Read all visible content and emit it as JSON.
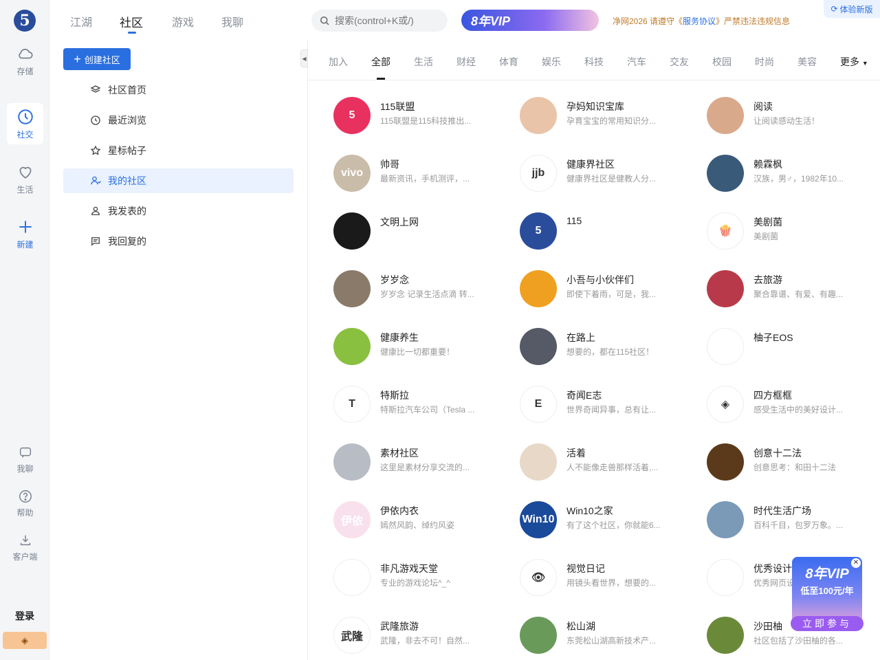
{
  "rail": {
    "logo": "5",
    "items": [
      {
        "label": "存储",
        "icon": "cloud-icon"
      },
      {
        "label": "社交",
        "icon": "compass-icon"
      },
      {
        "label": "生活",
        "icon": "heart-icon"
      },
      {
        "label": "新建",
        "icon": "plus-icon"
      }
    ],
    "bottom": [
      {
        "label": "我聊",
        "icon": "chat-icon"
      },
      {
        "label": "帮助",
        "icon": "help-icon"
      },
      {
        "label": "客户端",
        "icon": "download-icon"
      }
    ],
    "login": "登录"
  },
  "topnav": {
    "tabs": [
      "江湖",
      "社区",
      "游戏",
      "我聊"
    ],
    "active": "社区"
  },
  "search": {
    "placeholder": "搜索(control+K或/)"
  },
  "vip_banner": "8年VIP",
  "notice": {
    "pre": "净网2026 请遵守《",
    "link": "服务协议",
    "post": "》严禁违法违规信息"
  },
  "try_new": "体验新版",
  "create_button": "创建社区",
  "menu": [
    {
      "label": "社区首页",
      "icon": "layers-icon"
    },
    {
      "label": "最近浏览",
      "icon": "history-icon"
    },
    {
      "label": "星标帖子",
      "icon": "star-icon"
    },
    {
      "label": "我的社区",
      "icon": "user-group-icon"
    },
    {
      "label": "我发表的",
      "icon": "user-icon"
    },
    {
      "label": "我回复的",
      "icon": "comment-icon"
    }
  ],
  "categories": [
    "加入",
    "全部",
    "生活",
    "财经",
    "体育",
    "娱乐",
    "科技",
    "汽车",
    "交友",
    "校园",
    "时尚",
    "美容"
  ],
  "more": "更多",
  "communities": [
    {
      "name": "115联盟",
      "desc": "115联盟是115科技推出...",
      "color": "#e8315f",
      "glyph": "5"
    },
    {
      "name": "孕妈知识宝库",
      "desc": "孕育宝宝的常用知识分...",
      "color": "#e9c4a8",
      "glyph": ""
    },
    {
      "name": "阅读",
      "desc": "让阅读感动生活！",
      "color": "#d9a98c",
      "glyph": ""
    },
    {
      "name": "帅哥",
      "desc": "最新资讯，手机测评，...",
      "color": "#c9bda9",
      "glyph": "vivo"
    },
    {
      "name": "健康界社区",
      "desc": "健康界社区是健教人分...",
      "color": "#ffffff",
      "glyph": "jjb"
    },
    {
      "name": "赖霖枫",
      "desc": "汉族，男♂，1982年10...",
      "color": "#3a5a7a",
      "glyph": ""
    },
    {
      "name": "文明上网",
      "desc": "",
      "color": "#1a1a1a",
      "glyph": ""
    },
    {
      "name": "115",
      "desc": "",
      "color": "#2a4d9b",
      "glyph": "5"
    },
    {
      "name": "美剧菌",
      "desc": "美剧菌",
      "color": "#ffffff",
      "glyph": "🍿"
    },
    {
      "name": "岁岁念",
      "desc": "岁岁念 记录生活点滴 转...",
      "color": "#8a7a6a",
      "glyph": ""
    },
    {
      "name": "小吾与小伙伴们",
      "desc": "即使下着雨，可是，我...",
      "color": "#f0a020",
      "glyph": ""
    },
    {
      "name": "去旅游",
      "desc": "聚合靠谱、有爱、有趣...",
      "color": "#b83a4a",
      "glyph": ""
    },
    {
      "name": "健康养生",
      "desc": "健康比一切都重要！",
      "color": "#8ac040",
      "glyph": ""
    },
    {
      "name": "在路上",
      "desc": "想要的，都在115社区！",
      "color": "#555a66",
      "glyph": ""
    },
    {
      "name": "柚子EOS",
      "desc": "",
      "color": "#ffffff",
      "glyph": ""
    },
    {
      "name": "特斯拉",
      "desc": "特斯拉汽车公司（Tesla ...",
      "color": "#ffffff",
      "glyph": "T"
    },
    {
      "name": "奇闻E志",
      "desc": "世界奇闻异事，总有让...",
      "color": "#ffffff",
      "glyph": "E"
    },
    {
      "name": "四方框框",
      "desc": "感受生活中的美好设计...",
      "color": "#ffffff",
      "glyph": "◈"
    },
    {
      "name": "素材社区",
      "desc": "这里是素材分享交流的...",
      "color": "#b8bcc4",
      "glyph": ""
    },
    {
      "name": "活着",
      "desc": "人不能像走兽那样活着,...",
      "color": "#e8d8c8",
      "glyph": ""
    },
    {
      "name": "创意十二法",
      "desc": "创意思考：和田十二法",
      "color": "#5a3a1a",
      "glyph": ""
    },
    {
      "name": "伊依内衣",
      "desc": "嫣然风韵、绰约风姿",
      "color": "#f8e0ec",
      "glyph": "伊依"
    },
    {
      "name": "Win10之家",
      "desc": "有了这个社区，你就能6...",
      "color": "#1a4a9a",
      "glyph": "Win10"
    },
    {
      "name": "时代生活广场",
      "desc": "百科千目，包罗万象。...",
      "color": "#7a9ab8",
      "glyph": ""
    },
    {
      "name": "非凡游戏天堂",
      "desc": "专业的游戏论坛^_^",
      "color": "#ffffff",
      "glyph": ""
    },
    {
      "name": "视觉日记",
      "desc": "用镜头看世界，想要的...",
      "color": "#ffffff",
      "glyph": "👁"
    },
    {
      "name": "优秀设计",
      "desc": "优秀网页设",
      "color": "#ffffff",
      "glyph": ""
    },
    {
      "name": "武隆旅游",
      "desc": "武隆，非去不可！自然...",
      "color": "#ffffff",
      "glyph": "武隆"
    },
    {
      "name": "松山湖",
      "desc": "东莞松山湖高新技术产...",
      "color": "#6a9a5a",
      "glyph": ""
    },
    {
      "name": "沙田柚",
      "desc": "社区包括了沙田柚的各...",
      "color": "#6a8a3a",
      "glyph": ""
    }
  ],
  "float_ad": {
    "line1": "8年VIP",
    "line2": "低至100元/年",
    "cta": "立即参与"
  }
}
